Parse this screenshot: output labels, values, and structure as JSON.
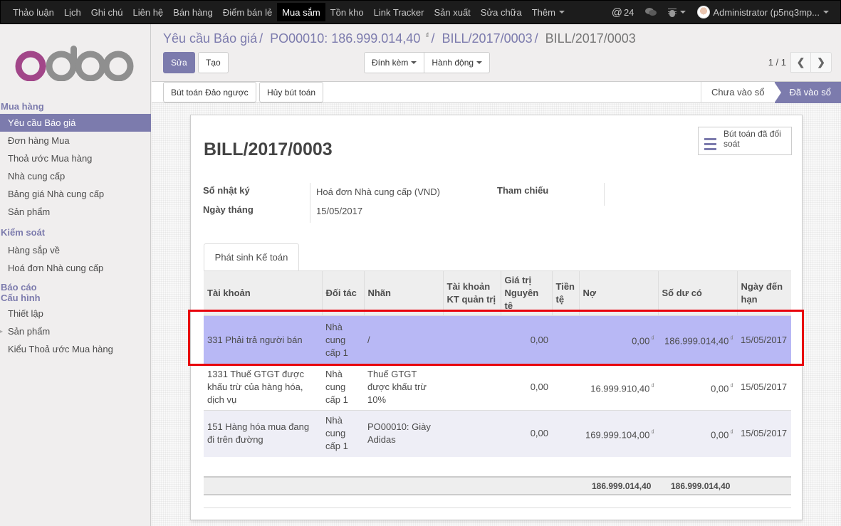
{
  "topnav": {
    "menu": [
      "Thảo luận",
      "Lịch",
      "Ghi chú",
      "Liên hệ",
      "Bán hàng",
      "Điểm bán lẻ",
      "Mua sắm",
      "Tồn kho",
      "Link Tracker",
      "Sản xuất",
      "Sửa chữa"
    ],
    "active_menu": "Mua sắm",
    "more_label": "Thêm",
    "mentions_count": "24",
    "mentions_icon": "at-icon",
    "chat_icon": "chat-icon",
    "debug_icon": "bug-icon",
    "user_label": "Administrator (p5nq3mp..."
  },
  "sidebar": {
    "logo": "odoo",
    "sections": [
      {
        "title": "Mua hàng",
        "items": [
          "Yêu cầu Báo giá",
          "Đơn hàng Mua",
          "Thoả ước Mua hàng",
          "Nhà cung cấp",
          "Bảng giá Nhà cung cấp",
          "Sản phẩm"
        ]
      },
      {
        "title": "Kiểm soát",
        "items": [
          "Hàng sắp về",
          "Hoá đơn Nhà cung cấp"
        ]
      },
      {
        "title": "Báo cáo",
        "items": []
      },
      {
        "title": "Cấu hình",
        "items": [
          "Thiết lập",
          "Sản phẩm",
          "Kiểu Thoả ước Mua hàng"
        ]
      }
    ],
    "active_item": "Yêu cầu Báo giá"
  },
  "breadcrumb": {
    "items": [
      "Yêu cầu Báo giá",
      "PO00010: 186.999.014,40",
      "BILL/2017/0003"
    ],
    "currency_symbol": "₫",
    "current": "BILL/2017/0003"
  },
  "toolbar": {
    "edit_label": "Sửa",
    "create_label": "Tạo",
    "attach_label": "Đính kèm",
    "action_label": "Hành động",
    "pager_value": "1 / 1",
    "prev_icon": "chevron-left-icon",
    "next_icon": "chevron-right-icon"
  },
  "statusbar": {
    "reverse_label": "Bút toán Đảo ngược",
    "cancel_label": "Hủy bút toán",
    "stages": [
      "Chưa vào sổ",
      "Đã vào sổ"
    ],
    "active_stage": "Đã vào sổ"
  },
  "form": {
    "title": "BILL/2017/0003",
    "smart_button": "Bút toán đã đối soát",
    "journal_label": "Sổ nhật ký",
    "journal_value": "Hoá đơn Nhà cung cấp (VND)",
    "date_label": "Ngày tháng",
    "date_value": "15/05/2017",
    "ref_label": "Tham chiếu",
    "ref_value": "",
    "tab_label": "Phát sinh Kế toán"
  },
  "lines": {
    "columns": [
      "Tài khoản",
      "Đối tác",
      "Nhãn",
      "Tài khoản KT quản trị",
      "Giá trị Nguyên tệ",
      "Tiền tệ",
      "Nợ",
      "Số dư có",
      "Ngày đến hạn"
    ],
    "rows": [
      {
        "account": "331 Phải trả người bán",
        "partner": "Nhà cung cấp 1",
        "label": "/",
        "analytic": "",
        "amount_currency": "0,00",
        "currency": "",
        "debit": "0,00",
        "credit": "186.999.014,40",
        "due": "15/05/2017",
        "selected": true
      },
      {
        "account": "1331 Thuế GTGT được khấu trừ của hàng hóa, dịch vụ",
        "partner": "Nhà cung cấp 1",
        "label": "Thuế GTGT được khấu trừ 10%",
        "analytic": "",
        "amount_currency": "0,00",
        "currency": "",
        "debit": "16.999.910,40",
        "credit": "0,00",
        "due": "15/05/2017",
        "selected": false
      },
      {
        "account": "151 Hàng hóa mua đang đi trên đường",
        "partner": "Nhà cung cấp 1",
        "label": "PO00010: Giày Adidas",
        "analytic": "",
        "amount_currency": "0,00",
        "currency": "",
        "debit": "169.999.104,00",
        "credit": "0,00",
        "due": "15/05/2017",
        "selected": false
      }
    ],
    "currency_symbol": "₫",
    "total_debit": "186.999.014,40",
    "total_credit": "186.999.014,40"
  },
  "colors": {
    "brand": "#7c7bad",
    "selected_row": "#b8b8f5",
    "highlight_box": "#e8000c",
    "topbar": "#1c1c1c"
  }
}
